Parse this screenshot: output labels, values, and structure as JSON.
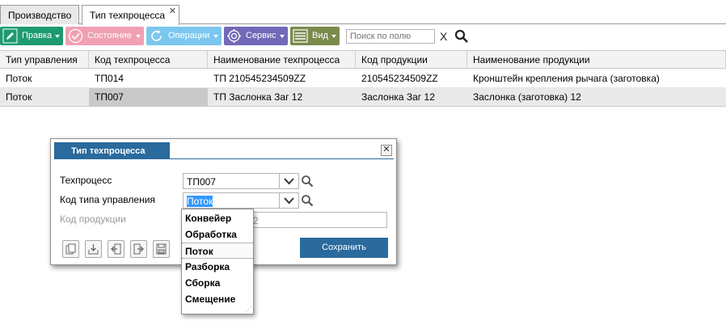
{
  "tabs": [
    {
      "label": "Производство"
    },
    {
      "label": "Тип техпроцесса",
      "close": "✕"
    }
  ],
  "toolbar": {
    "edit_label": "Правка",
    "state_label": "Состояние",
    "operations_label": "Операции",
    "service_label": "Сервис",
    "view_label": "Вид",
    "search_placeholder": "Поиск по полю",
    "clear_label": "X"
  },
  "grid": {
    "columns": [
      "Тип управления",
      "Код техпроцесса",
      "Наименование техпроцесса",
      "Код продукции",
      "Наименование продукции"
    ],
    "rows": [
      [
        "Поток",
        "ТП014",
        "ТП 210545234509ZZ",
        "210545234509ZZ",
        "Кронштейн крепления рычага (заготовка)"
      ],
      [
        "Поток",
        "ТП007",
        "ТП Заслонка Заг 12",
        "Заслонка Заг 12",
        "Заслонка (заготовка) 12"
      ]
    ]
  },
  "dialog": {
    "title": "Тип техпроцесса",
    "close": "✕",
    "fields": {
      "process_label": "Техпроцесс",
      "process_value": "ТП007",
      "control_type_label": "Код типа управления",
      "control_type_value": "Поток",
      "product_label": "Код продукции",
      "product_value_visible": "2"
    },
    "save_label": "Сохранить"
  },
  "dropdown": {
    "options": [
      "Конвейер",
      "Обработка",
      "Поток",
      "Разборка",
      "Сборка",
      "Смещение"
    ],
    "highlighted": "Поток"
  },
  "colors": {
    "accent_blue": "#2a6a9d",
    "edit_green": "#1e9a72",
    "state_pink": "#f0a0b2",
    "operations_blue": "#7cc7ef",
    "service_purple": "#7268b8",
    "view_olive": "#7a8b4c"
  }
}
